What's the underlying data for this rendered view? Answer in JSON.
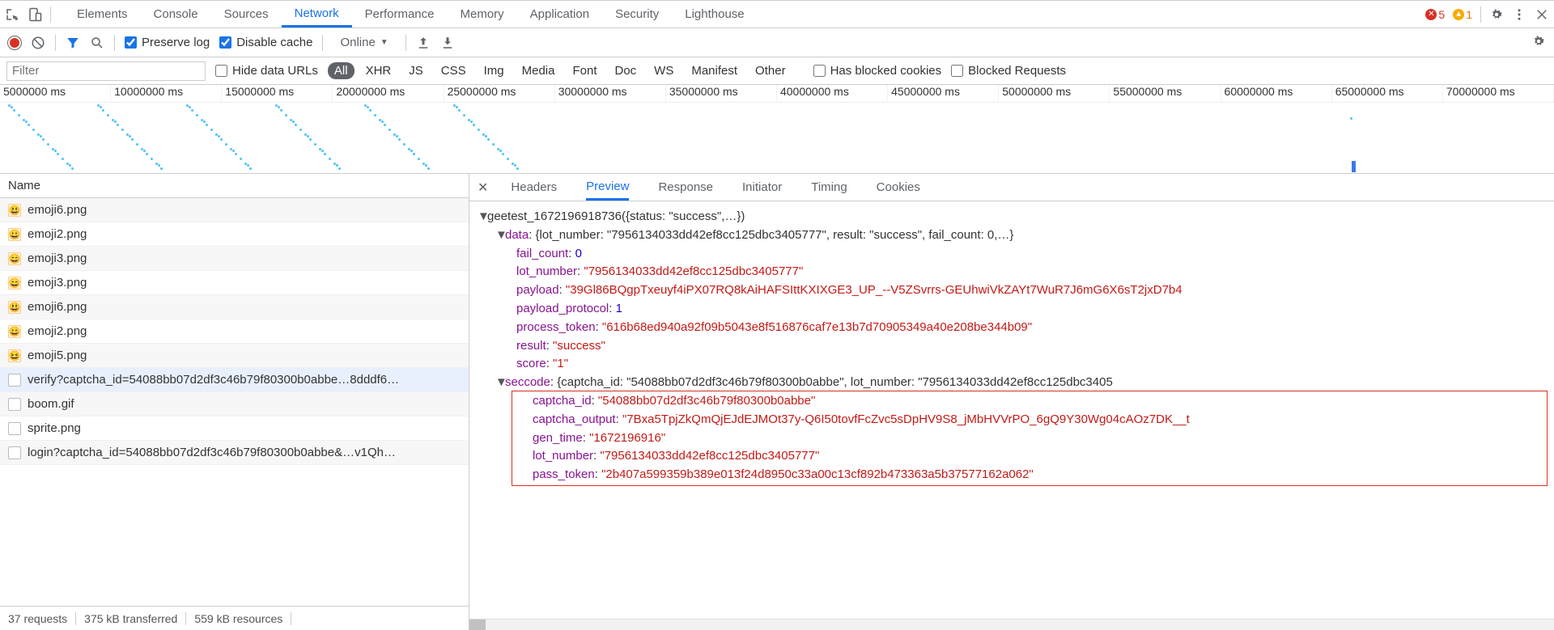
{
  "topbar": {
    "tabs": [
      "Elements",
      "Console",
      "Sources",
      "Network",
      "Performance",
      "Memory",
      "Application",
      "Security",
      "Lighthouse"
    ],
    "active_tab": 3,
    "error_count": "5",
    "warn_count": "1"
  },
  "toolbar": {
    "preserve_log_label": "Preserve log",
    "disable_cache_label": "Disable cache",
    "throttle_label": "Online"
  },
  "filterbar": {
    "filter_placeholder": "Filter",
    "hide_data_urls_label": "Hide data URLs",
    "types": [
      "All",
      "XHR",
      "JS",
      "CSS",
      "Img",
      "Media",
      "Font",
      "Doc",
      "WS",
      "Manifest",
      "Other"
    ],
    "active_type": 0,
    "blocked_cookies_label": "Has blocked cookies",
    "blocked_requests_label": "Blocked Requests"
  },
  "timeline": {
    "ticks": [
      "5000000 ms",
      "10000000 ms",
      "15000000 ms",
      "20000000 ms",
      "25000000 ms",
      "30000000 ms",
      "35000000 ms",
      "40000000 ms",
      "45000000 ms",
      "50000000 ms",
      "55000000 ms",
      "60000000 ms",
      "65000000 ms",
      "70000000 ms"
    ]
  },
  "requests": {
    "name_header": "Name",
    "rows": [
      {
        "icon": "img",
        "emoji": "😃",
        "name": "emoji6.png"
      },
      {
        "icon": "img",
        "emoji": "😀",
        "name": "emoji2.png"
      },
      {
        "icon": "img",
        "emoji": "😄",
        "name": "emoji3.png"
      },
      {
        "icon": "img",
        "emoji": "😄",
        "name": "emoji3.png"
      },
      {
        "icon": "img",
        "emoji": "😃",
        "name": "emoji6.png"
      },
      {
        "icon": "img",
        "emoji": "😀",
        "name": "emoji2.png"
      },
      {
        "icon": "img",
        "emoji": "😆",
        "name": "emoji5.png"
      },
      {
        "icon": "doc",
        "emoji": "",
        "name": "verify?captcha_id=54088bb07d2df3c46b79f80300b0abbe…8dddf6…"
      },
      {
        "icon": "doc",
        "emoji": "",
        "name": "boom.gif"
      },
      {
        "icon": "doc",
        "emoji": "",
        "name": "sprite.png"
      },
      {
        "icon": "doc",
        "emoji": "",
        "name": "login?captcha_id=54088bb07d2df3c46b79f80300b0abbe&…v1Qh…"
      }
    ],
    "selected_index": 7,
    "footer": {
      "count": "37 requests",
      "transferred": "375 kB transferred",
      "resources": "559 kB resources"
    }
  },
  "preview": {
    "tabs": [
      "Headers",
      "Preview",
      "Response",
      "Initiator",
      "Timing",
      "Cookies"
    ],
    "active_tab": 1,
    "callback_name": "geetest_1672196918736",
    "callback_summary": "({status: \"success\",…})",
    "data_summary": "{lot_number: \"7956134033dd42ef8cc125dbc3405777\", result: \"success\", fail_count: 0,…}",
    "data": {
      "fail_count": "0",
      "lot_number": "7956134033dd42ef8cc125dbc3405777",
      "payload": "39Gl86BQgpTxeuyf4iPX07RQ8kAiHAFSIttKXIXGE3_UP_--V5ZSvrrs-GEUhwiVkZAYt7WuR7J6mG6X6sT2jxD7b4",
      "payload_protocol": "1",
      "process_token": "616b68ed940a92f09b5043e8f516876caf7e13b7d70905349a40e208be344b09",
      "result": "success",
      "score": "1"
    },
    "seccode_summary": "{captcha_id: \"54088bb07d2df3c46b79f80300b0abbe\", lot_number: \"7956134033dd42ef8cc125dbc3405",
    "seccode": {
      "captcha_id": "54088bb07d2df3c46b79f80300b0abbe",
      "captcha_output": "7Bxa5TpjZkQmQjEJdEJMOt37y-Q6I50tovfFcZvc5sDpHV9S8_jMbHVVrPO_6gQ9Y30Wg04cAOz7DK__t",
      "gen_time": "1672196916",
      "lot_number": "7956134033dd42ef8cc125dbc3405777",
      "pass_token": "2b407a599359b389e013f24d8950c33a00c13cf892b473363a5b37577162a062"
    }
  }
}
